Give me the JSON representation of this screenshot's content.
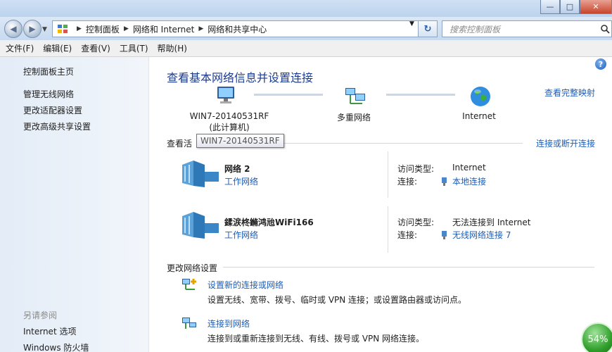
{
  "window": {
    "minimize_glyph": "—",
    "maximize_glyph": "□",
    "close_glyph": "✕"
  },
  "address": {
    "crumbs": [
      "控制面板",
      "网络和 Internet",
      "网络和共享中心"
    ],
    "search_placeholder": "搜索控制面板"
  },
  "menu": [
    "文件(F)",
    "编辑(E)",
    "查看(V)",
    "工具(T)",
    "帮助(H)"
  ],
  "sidebar": {
    "items": [
      "控制面板主页",
      "管理无线网络",
      "更改适配器设置",
      "更改高级共享设置"
    ],
    "see_also_heading": "另请参阅",
    "see_also": [
      "Internet 选项",
      "Windows 防火墙"
    ]
  },
  "main": {
    "title": "查看基本网络信息并设置连接",
    "full_map_link": "查看完整映射",
    "nodes": {
      "computer_name": "WIN7-20140531RF",
      "computer_sub": "(此计算机)",
      "multi": "多重网络",
      "internet": "Internet"
    },
    "tooltip": "WIN7-20140531RF",
    "active_heading_partial": "查看活",
    "connect_link": "连接或断开连接",
    "networks": [
      {
        "name": "网络  2",
        "type": "工作网络",
        "access_label": "访问类型:",
        "access_value": "Internet",
        "conn_label": "连接:",
        "conn_value": "本地连接"
      },
      {
        "name": "鍒涙柊鏅鸿兘WiFi166",
        "type": "工作网络",
        "access_label": "访问类型:",
        "access_value": "无法连接到 Internet",
        "conn_label": "连接:",
        "conn_value": "无线网络连接 7"
      }
    ],
    "change_heading": "更改网络设置",
    "tasks": [
      {
        "link": "设置新的连接或网络",
        "desc": "设置无线、宽带、拨号、临时或 VPN 连接；或设置路由器或访问点。"
      },
      {
        "link": "连接到网络",
        "desc": "连接到或重新连接到无线、有线、拨号或 VPN 网络连接。"
      }
    ],
    "help_glyph": "?"
  },
  "overlay": {
    "progress_percent": "54%"
  },
  "colors": {
    "link": "#1c5db8",
    "title": "#1d3c8f"
  }
}
